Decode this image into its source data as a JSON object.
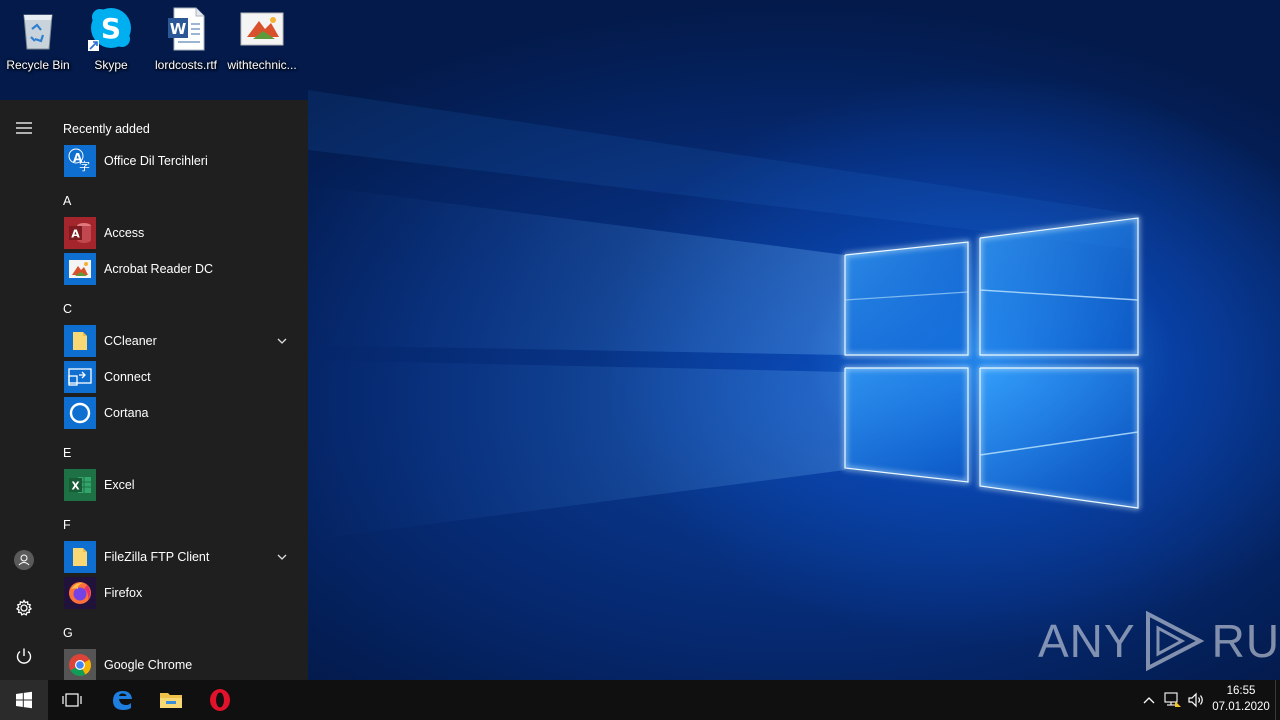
{
  "desktop": {
    "icons": [
      {
        "label": "Recycle Bin",
        "icon": "recycle-bin-icon"
      },
      {
        "label": "Skype",
        "icon": "skype-icon"
      },
      {
        "label": "lordcosts.rtf",
        "icon": "word-document-icon"
      },
      {
        "label": "withtechnic...",
        "icon": "image-file-icon"
      }
    ]
  },
  "start_menu": {
    "recently_added_label": "Recently added",
    "recent_apps": [
      {
        "name": "Office Dil Tercihleri",
        "icon": "office-language-icon"
      }
    ],
    "sections": [
      {
        "letter": "A",
        "apps": [
          {
            "name": "Access",
            "icon": "access-icon"
          },
          {
            "name": "Acrobat Reader DC",
            "icon": "acrobat-icon"
          }
        ]
      },
      {
        "letter": "C",
        "apps": [
          {
            "name": "CCleaner",
            "icon": "folder-icon",
            "expandable": true
          },
          {
            "name": "Connect",
            "icon": "connect-icon"
          },
          {
            "name": "Cortana",
            "icon": "cortana-icon"
          }
        ]
      },
      {
        "letter": "E",
        "apps": [
          {
            "name": "Excel",
            "icon": "excel-icon"
          }
        ]
      },
      {
        "letter": "F",
        "apps": [
          {
            "name": "FileZilla FTP Client",
            "icon": "folder-icon",
            "expandable": true
          },
          {
            "name": "Firefox",
            "icon": "firefox-icon"
          }
        ]
      },
      {
        "letter": "G",
        "apps": [
          {
            "name": "Google Chrome",
            "icon": "chrome-icon"
          }
        ]
      }
    ],
    "rail": [
      "hamburger-menu-icon",
      "user-icon",
      "settings-icon",
      "power-icon"
    ]
  },
  "watermark": {
    "left": "ANY",
    "right": "RUN"
  },
  "taskbar": {
    "pinned": [
      "start-windows-icon",
      "task-view-icon",
      "edge-icon",
      "file-explorer-icon",
      "opera-icon"
    ],
    "tray": [
      "show-hidden-icons-chevron",
      "network-icon",
      "volume-icon"
    ],
    "clock": {
      "time": "16:55",
      "date": "07.01.2020"
    }
  },
  "colors": {
    "start_menu_bg": "#1f1f1f",
    "tile_blue": "#0e6fd1",
    "taskbar_bg": "#101010",
    "access_red": "#a4262c",
    "excel_green": "#1e7145"
  }
}
